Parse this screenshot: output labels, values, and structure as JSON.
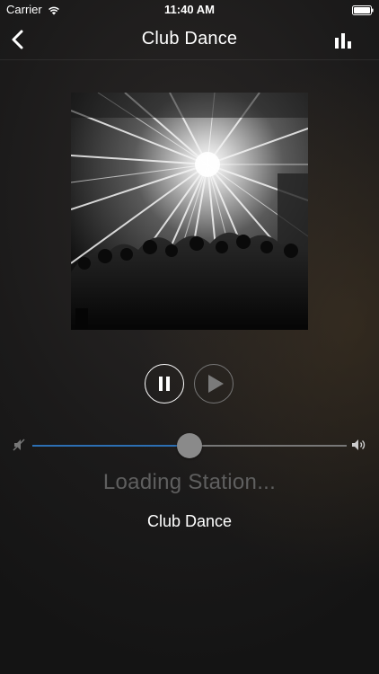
{
  "status_bar": {
    "carrier": "Carrier",
    "time": "11:40 AM",
    "icons": [
      "wifi-icon",
      "battery-icon"
    ]
  },
  "nav": {
    "title": "Club Dance",
    "back_icon": "chevron-left-icon",
    "right_icon": "bar-chart-icon"
  },
  "artwork": {
    "icon": "album-art-club-crowd-lasers"
  },
  "controls": {
    "pause_icon": "pause-icon",
    "play_icon": "play-icon"
  },
  "volume": {
    "level": 0.5,
    "min_icon": "volume-mute-icon",
    "max_icon": "volume-high-icon",
    "accent_color": "#2c6fb3"
  },
  "status_text": "Loading Station...",
  "station_name": "Club Dance"
}
